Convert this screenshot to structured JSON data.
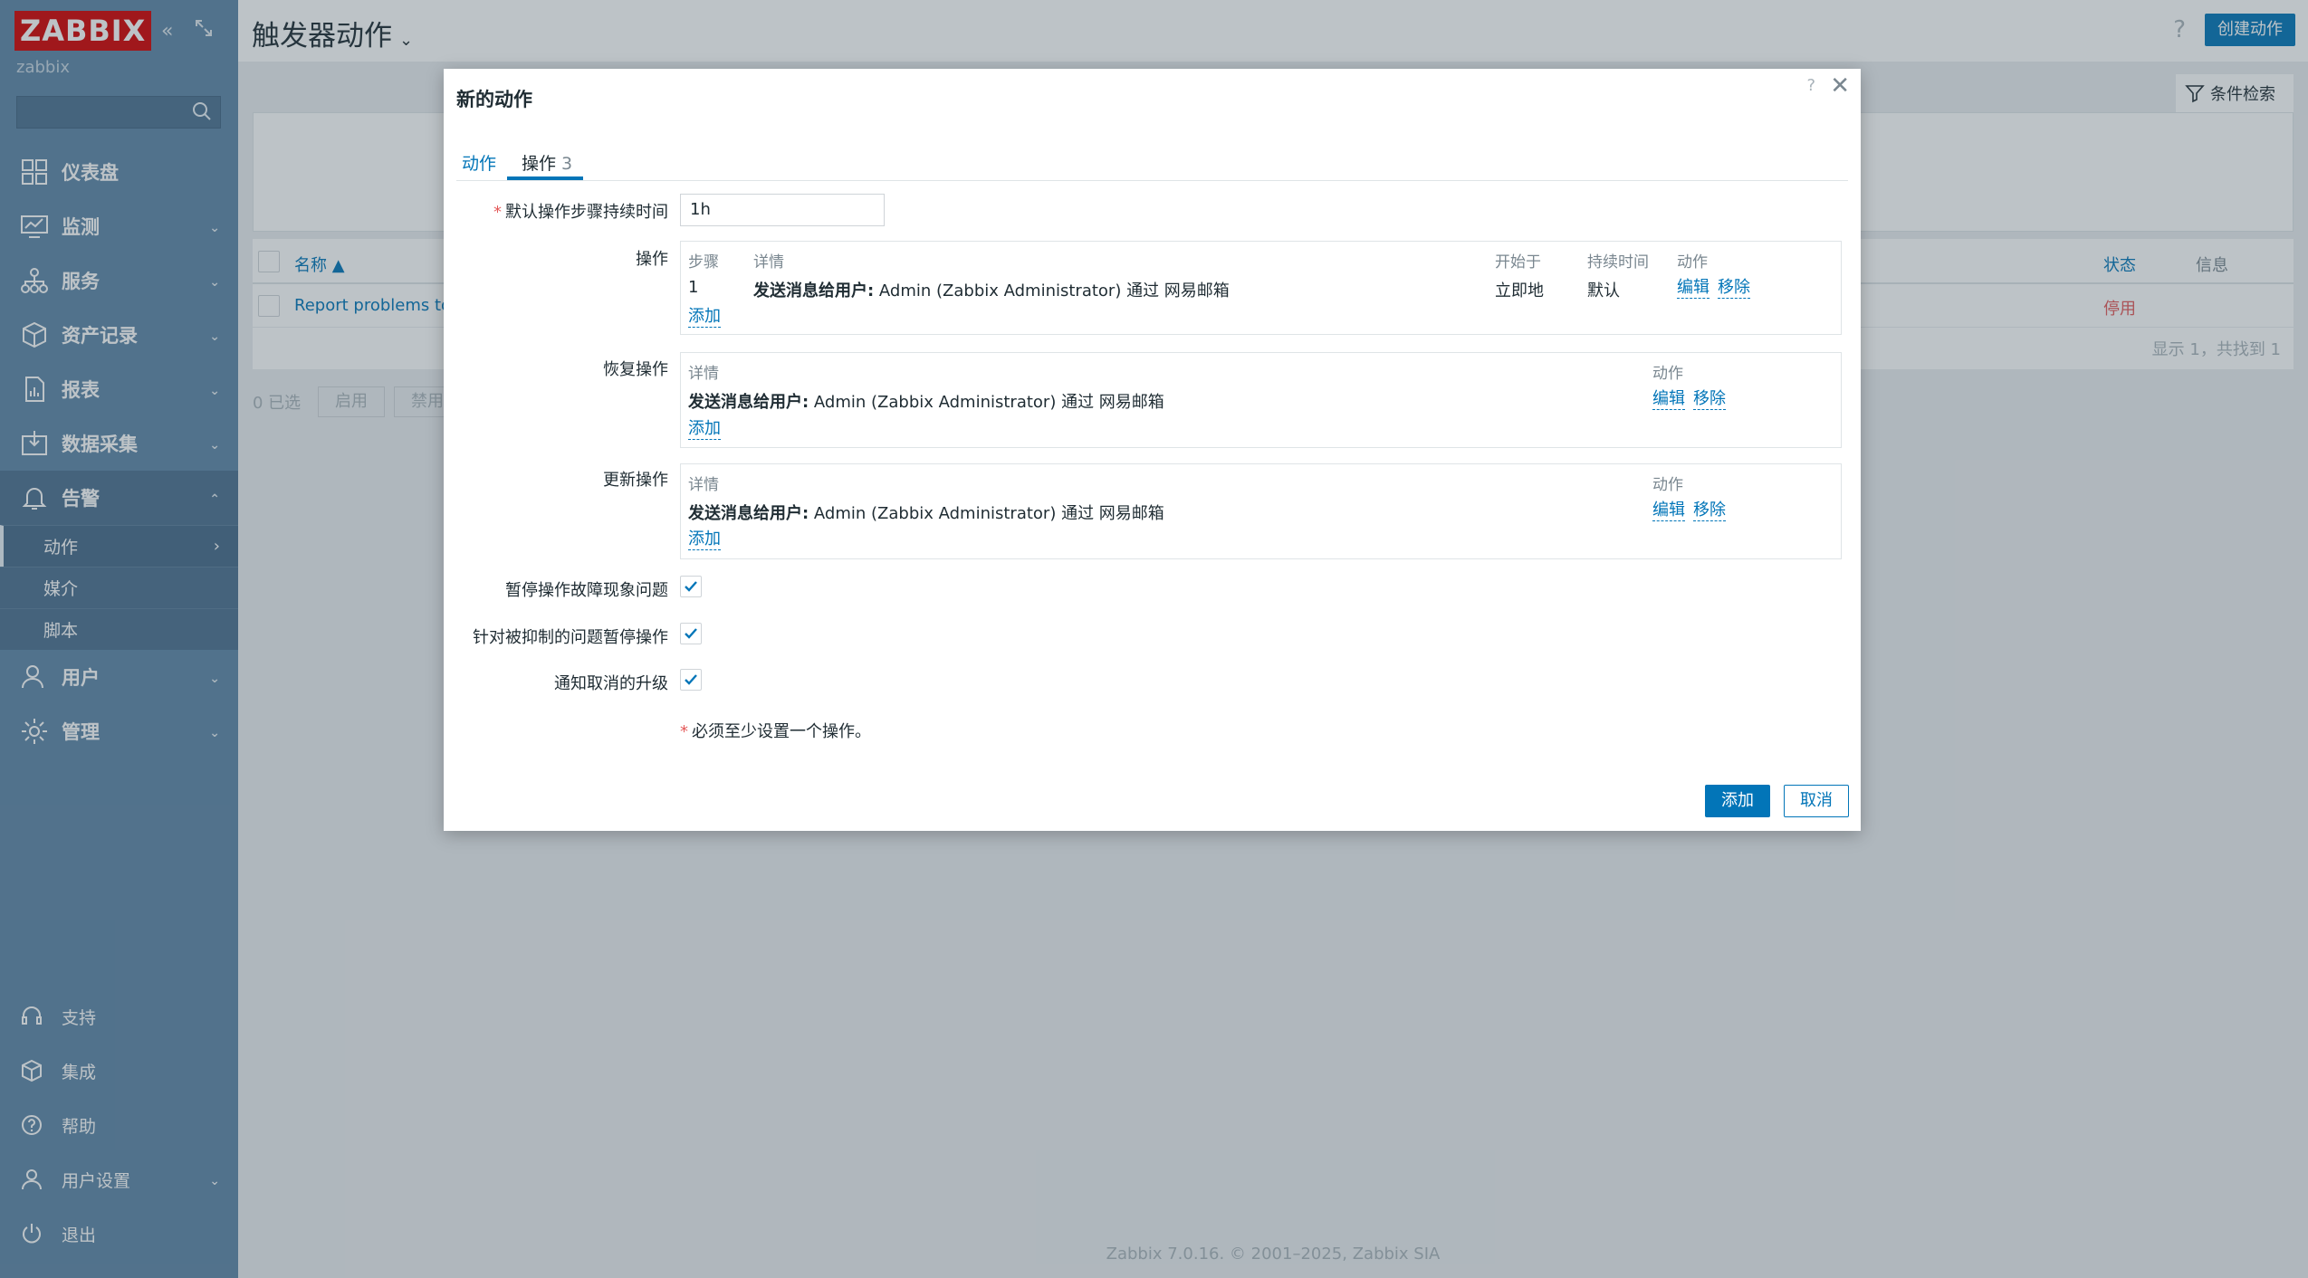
{
  "app": {
    "logo_text": "ZABBIX",
    "server_name": "zabbix",
    "colors": {
      "accent": "#0275b8",
      "sidebar": "#5f87a7",
      "logo": "#d40000",
      "danger": "#e45959"
    }
  },
  "sidebar": {
    "menu": [
      {
        "label": "仪表盘",
        "icon": "dashboard-icon"
      },
      {
        "label": "监测",
        "icon": "monitoring-icon"
      },
      {
        "label": "服务",
        "icon": "services-icon"
      },
      {
        "label": "资产记录",
        "icon": "inventory-icon"
      },
      {
        "label": "报表",
        "icon": "reports-icon"
      },
      {
        "label": "数据采集",
        "icon": "data-collection-icon"
      },
      {
        "label": "告警",
        "icon": "alerts-icon"
      },
      {
        "label": "用户",
        "icon": "users-icon"
      },
      {
        "label": "管理",
        "icon": "administration-icon"
      }
    ],
    "alerts_submenu": [
      "动作",
      "媒介",
      "脚本"
    ],
    "bottom": [
      {
        "label": "支持",
        "icon": "support-icon"
      },
      {
        "label": "集成",
        "icon": "integrations-icon"
      },
      {
        "label": "帮助",
        "icon": "help-icon"
      },
      {
        "label": "用户设置",
        "icon": "user-settings-icon"
      },
      {
        "label": "退出",
        "icon": "power-icon"
      }
    ]
  },
  "header": {
    "title": "触发器动作",
    "help": "?",
    "create_button": "创建动作",
    "filter_tab": "条件检索"
  },
  "list": {
    "columns": {
      "name": "名称 ▲",
      "status": "状态",
      "info": "信息"
    },
    "rows": [
      {
        "name": "Report problems to Z",
        "status": "停用"
      }
    ],
    "paging": "显示 1，共找到 1",
    "selected": "0 已选",
    "enable_button": "启用",
    "disable_button": "禁用"
  },
  "dialog": {
    "title": "新的动作",
    "help": "?",
    "close": "✕",
    "tabs": [
      {
        "label": "动作"
      },
      {
        "label": "操作",
        "count": "3"
      }
    ],
    "default_duration_label": "默认操作步骤持续时间",
    "default_duration_value": "1h",
    "operations": {
      "label": "操作",
      "headers": {
        "step": "步骤",
        "details": "详情",
        "start_in": "开始于",
        "duration": "持续时间",
        "action": "动作"
      },
      "rows": [
        {
          "step": "1",
          "details_bold": "发送消息给用户:",
          "details_text": " Admin (Zabbix Administrator) 通过 网易邮箱",
          "start_in": "立即地",
          "duration": "默认",
          "edit": "编辑",
          "remove": "移除"
        }
      ],
      "add": "添加"
    },
    "recovery": {
      "label": "恢复操作",
      "headers": {
        "details": "详情",
        "action": "动作"
      },
      "rows": [
        {
          "details_bold": "发送消息给用户:",
          "details_text": " Admin (Zabbix Administrator) 通过 网易邮箱",
          "edit": "编辑",
          "remove": "移除"
        }
      ],
      "add": "添加"
    },
    "update": {
      "label": "更新操作",
      "headers": {
        "details": "详情",
        "action": "动作"
      },
      "rows": [
        {
          "details_bold": "发送消息给用户:",
          "details_text": " Admin (Zabbix Administrator) 通过 网易邮箱",
          "edit": "编辑",
          "remove": "移除"
        }
      ],
      "add": "添加"
    },
    "checkboxes": [
      {
        "label": "暂停操作故障现象问题",
        "checked": true
      },
      {
        "label": "针对被抑制的问题暂停操作",
        "checked": true
      },
      {
        "label": "通知取消的升级",
        "checked": true
      }
    ],
    "note": "必须至少设置一个操作。",
    "add_button": "添加",
    "cancel_button": "取消"
  },
  "footer": "Zabbix 7.0.16. © 2001–2025, Zabbix SIA"
}
